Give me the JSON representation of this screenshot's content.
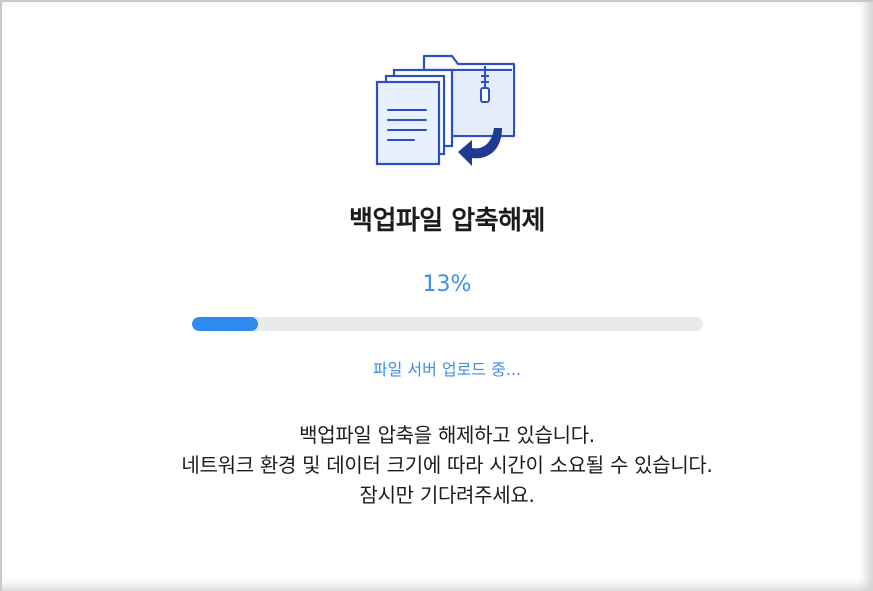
{
  "dialog": {
    "title": "백업파일 압축해제",
    "illustration_icon": "zip-folder-extract-icon",
    "progress": {
      "percent_label": "13%",
      "value": 0.13,
      "status": "파일 서버 업로드 중..."
    },
    "message_lines": [
      "백업파일 압축을 해제하고 있습니다.",
      "네트워크 환경 및 데이터 크기에 따라 시간이 소요될 수 있습니다.",
      "잠시만 기다려주세요."
    ]
  },
  "colors": {
    "accent": "#2d8bf0",
    "accent_text": "#3f8fe6",
    "track": "#e9eaec",
    "icon_stroke": "#2b4fc9",
    "arrow": "#1f3a93"
  }
}
